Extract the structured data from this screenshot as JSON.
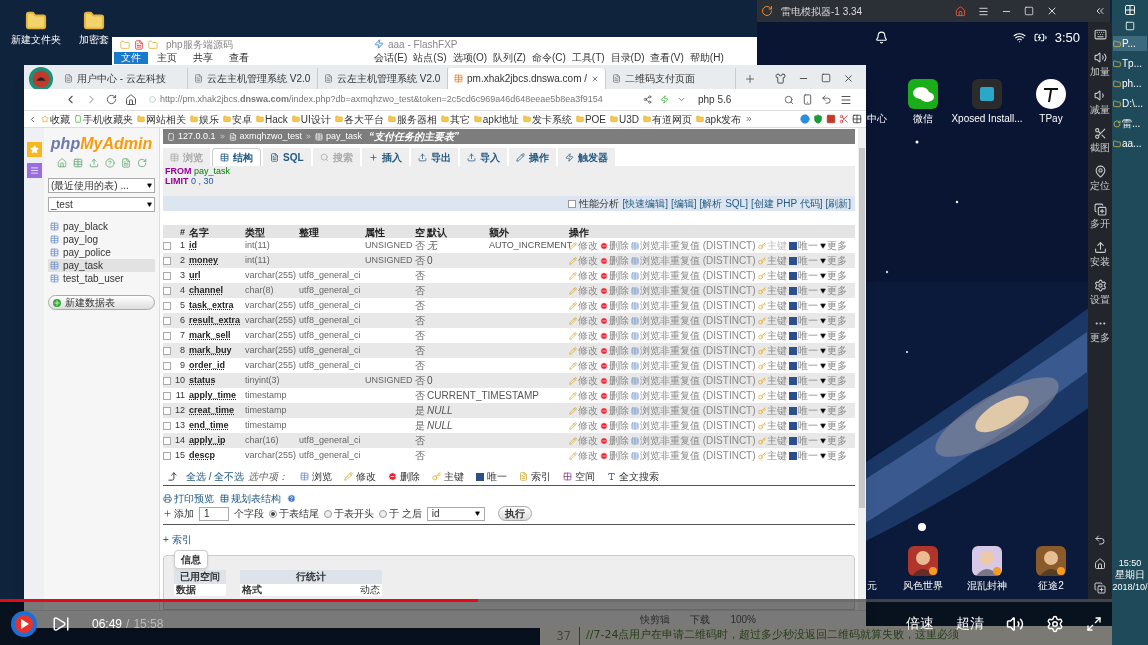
{
  "desktop": {
    "icons": [
      {
        "label": "新建文件夹"
      },
      {
        "label": "加密套"
      }
    ]
  },
  "explorer": {
    "title": "php服务端源码",
    "ribbon": [
      {
        "label": "文件",
        "selected": true
      },
      {
        "label": "主页",
        "selected": false
      },
      {
        "label": "共享",
        "selected": false
      },
      {
        "label": "查看",
        "selected": false
      }
    ]
  },
  "flashfxp": {
    "title": "aaa - FlashFXP",
    "menu": [
      "会话(E)",
      "站点(S)",
      "选项(O)",
      "队列(Z)",
      "命令(C)",
      "工具(T)",
      "目录(D)",
      "查看(V)",
      "帮助(H)"
    ]
  },
  "browser": {
    "tabs": [
      {
        "label": "用户中心 - 云左科技",
        "selected": false
      },
      {
        "label": "云左主机管理系统 V2.0",
        "selected": false
      },
      {
        "label": "云左主机管理系统 V2.0",
        "selected": false
      },
      {
        "label": "pm.xhak2jbcs.dnswa.com /",
        "selected": true
      },
      {
        "label": "二维码支付页面",
        "selected": false
      }
    ],
    "url": "http://pm.xhak2jbcs.**dnswa.com**/index.php?db=axmqhzwo_test&token=2c5cd6c969a46d648eeae5b8ea3f9154",
    "search": "php 5.6",
    "bookmarks": [
      "收藏",
      "手机收藏夹",
      "网站相关",
      "娱乐",
      "安卓",
      "Hack",
      "UI设计",
      "各大平台",
      "服务器相",
      "其它",
      "apk地址",
      "发卡系统",
      "POE",
      "U3D",
      "有道网页",
      "apk发布"
    ],
    "status": [
      "快剪辑",
      "下载",
      "100%"
    ]
  },
  "pma": {
    "logo": [
      "php",
      "MyAdmin"
    ],
    "sidebar": {
      "recent": "(最近使用的表) ...",
      "db": "_test",
      "tables": [
        {
          "name": "pay_black",
          "selected": false
        },
        {
          "name": "pay_log",
          "selected": false
        },
        {
          "name": "pay_police",
          "selected": false
        },
        {
          "name": "pay_task",
          "selected": true
        },
        {
          "name": "test_tab_user",
          "selected": false
        }
      ],
      "new_table": "新建数据表"
    },
    "breadcrumb": [
      "127.0.0.1",
      "axmqhzwo_test",
      "pay_task"
    ],
    "table_comment": "“支付任务的主要表”",
    "tabs": [
      {
        "label": "浏览",
        "selected": false,
        "disabled": true
      },
      {
        "label": "结构",
        "selected": true,
        "disabled": false
      },
      {
        "label": "SQL",
        "selected": false,
        "disabled": false
      },
      {
        "label": "搜索",
        "selected": false,
        "disabled": true
      },
      {
        "label": "插入",
        "selected": false,
        "disabled": false
      },
      {
        "label": "导出",
        "selected": false,
        "disabled": false
      },
      {
        "label": "导入",
        "selected": false,
        "disabled": false
      },
      {
        "label": "操作",
        "selected": false,
        "disabled": false
      },
      {
        "label": "触发器",
        "selected": false,
        "disabled": false
      }
    ],
    "sql": [
      {
        "keyword": "FROM",
        "rest": "pay_task"
      },
      {
        "keyword": "LIMIT",
        "rest": "0 , 30"
      }
    ],
    "profiling": {
      "label": "性能分析",
      "checked": false,
      "links": [
        "[快速编辑]",
        "[编辑]",
        "[解析 SQL]",
        "[创建 PHP 代码]",
        "[刷新]"
      ]
    },
    "columns": [
      "#",
      "名字",
      "类型",
      "整理",
      "属性",
      "空",
      "默认",
      "额外",
      "操作"
    ],
    "rows": [
      {
        "n": "1",
        "name": "id",
        "type": "int(11)",
        "collation": "",
        "attr": "UNSIGNED",
        "null": "否",
        "default": "无",
        "default_italic": true,
        "extra": "AUTO_INCREMENT",
        "checked": false,
        "primary": true,
        "actions": [
          "修改",
          "删除",
          "浏览非重复值 (DISTINCT)",
          "主键",
          "唯一",
          "更多"
        ]
      },
      {
        "n": "2",
        "name": "money",
        "type": "int(11)",
        "collation": "",
        "attr": "UNSIGNED",
        "null": "否",
        "default": "0",
        "default_italic": false,
        "extra": "",
        "checked": false,
        "primary": false,
        "actions": [
          "修改",
          "删除",
          "浏览非重复值 (DISTINCT)",
          "主键",
          "唯一",
          "更多"
        ]
      },
      {
        "n": "3",
        "name": "url",
        "type": "varchar(255)",
        "collation": "utf8_general_ci",
        "attr": "",
        "null": "否",
        "default": "",
        "extra": "",
        "checked": false,
        "primary": false,
        "actions": [
          "修改",
          "删除",
          "浏览非重复值 (DISTINCT)",
          "主键",
          "唯一",
          "更多"
        ]
      },
      {
        "n": "4",
        "name": "channel",
        "type": "char(8)",
        "collation": "utf8_general_ci",
        "attr": "",
        "null": "否",
        "default": "",
        "extra": "",
        "checked": false,
        "primary": false,
        "actions": [
          "修改",
          "删除",
          "浏览非重复值 (DISTINCT)",
          "主键",
          "唯一",
          "更多"
        ]
      },
      {
        "n": "5",
        "name": "task_extra",
        "type": "varchar(255)",
        "collation": "utf8_general_ci",
        "attr": "",
        "null": "否",
        "default": "",
        "extra": "",
        "checked": false,
        "primary": false,
        "actions": [
          "修改",
          "删除",
          "浏览非重复值 (DISTINCT)",
          "主键",
          "唯一",
          "更多"
        ]
      },
      {
        "n": "6",
        "name": "result_extra",
        "type": "varchar(255)",
        "collation": "utf8_general_ci",
        "attr": "",
        "null": "否",
        "default": "",
        "extra": "",
        "checked": false,
        "primary": false,
        "actions": [
          "修改",
          "删除",
          "浏览非重复值 (DISTINCT)",
          "主键",
          "唯一",
          "更多"
        ]
      },
      {
        "n": "7",
        "name": "mark_sell",
        "type": "varchar(255)",
        "collation": "utf8_general_ci",
        "attr": "",
        "null": "否",
        "default": "",
        "extra": "",
        "checked": false,
        "primary": false,
        "actions": [
          "修改",
          "删除",
          "浏览非重复值 (DISTINCT)",
          "主键",
          "唯一",
          "更多"
        ]
      },
      {
        "n": "8",
        "name": "mark_buy",
        "type": "varchar(255)",
        "collation": "utf8_general_ci",
        "attr": "",
        "null": "否",
        "default": "",
        "extra": "",
        "checked": false,
        "primary": false,
        "actions": [
          "修改",
          "删除",
          "浏览非重复值 (DISTINCT)",
          "主键",
          "唯一",
          "更多"
        ]
      },
      {
        "n": "9",
        "name": "order_id",
        "type": "varchar(255)",
        "collation": "utf8_general_ci",
        "attr": "",
        "null": "否",
        "default": "",
        "extra": "",
        "checked": false,
        "primary": false,
        "actions": [
          "修改",
          "删除",
          "浏览非重复值 (DISTINCT)",
          "主键",
          "唯一",
          "更多"
        ]
      },
      {
        "n": "10",
        "name": "status",
        "type": "tinyint(3)",
        "collation": "",
        "attr": "UNSIGNED",
        "null": "否",
        "default": "0",
        "default_italic": false,
        "extra": "",
        "checked": false,
        "primary": false,
        "actions": [
          "修改",
          "删除",
          "浏览非重复值 (DISTINCT)",
          "主键",
          "唯一",
          "更多"
        ]
      },
      {
        "n": "11",
        "name": "apply_time",
        "type": "timestamp",
        "collation": "",
        "attr": "",
        "null": "否",
        "default": "CURRENT_TIMESTAMP",
        "default_italic": false,
        "extra": "",
        "checked": false,
        "primary": false,
        "actions": [
          "修改",
          "删除",
          "浏览非重复值 (DISTINCT)",
          "主键",
          "唯一",
          "更多"
        ]
      },
      {
        "n": "12",
        "name": "creat_time",
        "type": "timestamp",
        "collation": "",
        "attr": "",
        "null": "是",
        "default": "NULL",
        "default_italic": true,
        "extra": "",
        "checked": false,
        "primary": false,
        "actions": [
          "修改",
          "删除",
          "浏览非重复值 (DISTINCT)",
          "主键",
          "唯一",
          "更多"
        ]
      },
      {
        "n": "13",
        "name": "end_time",
        "type": "timestamp",
        "collation": "",
        "attr": "",
        "null": "是",
        "default": "NULL",
        "default_italic": true,
        "extra": "",
        "checked": false,
        "primary": false,
        "actions": [
          "修改",
          "删除",
          "浏览非重复值 (DISTINCT)",
          "主键",
          "唯一",
          "更多"
        ]
      },
      {
        "n": "14",
        "name": "apply_ip",
        "type": "char(16)",
        "collation": "utf8_general_ci",
        "attr": "",
        "null": "否",
        "default": "",
        "extra": "",
        "checked": false,
        "primary": false,
        "actions": [
          "修改",
          "删除",
          "浏览非重复值 (DISTINCT)",
          "主键",
          "唯一",
          "更多"
        ]
      },
      {
        "n": "15",
        "name": "descp",
        "type": "varchar(255)",
        "collation": "utf8_general_ci",
        "attr": "",
        "null": "否",
        "default": "",
        "extra": "",
        "checked": false,
        "primary": false,
        "actions": [
          "修改",
          "删除",
          "浏览非重复值 (DISTINCT)",
          "主键",
          "唯一",
          "更多"
        ]
      }
    ],
    "bulk": {
      "select_all": "全选 / 全不选",
      "with_selected": "选中项：",
      "actions": [
        {
          "kind": "browse",
          "label": "浏览"
        },
        {
          "kind": "edit",
          "label": "修改"
        },
        {
          "kind": "drop",
          "label": "删除"
        },
        {
          "kind": "primary",
          "label": "主键"
        },
        {
          "kind": "unique",
          "label": "唯一"
        },
        {
          "kind": "index",
          "label": "索引"
        },
        {
          "kind": "spatial",
          "label": "空间"
        },
        {
          "kind": "fulltext",
          "label": "全文搜索"
        }
      ]
    },
    "print": "打印预览",
    "plan": "规划表结构",
    "add": {
      "label": "添加",
      "value": "1",
      "unit": "个字段",
      "positions": [
        {
          "label": "于表结尾",
          "selected": true
        },
        {
          "label": "于表开头",
          "selected": false
        },
        {
          "label": "于 之后",
          "selected": false
        }
      ],
      "after": "id",
      "go": "执行"
    },
    "index_link": "+ 索引",
    "info": {
      "legend": "信息",
      "headers": [
        "已用空间",
        "行统计"
      ],
      "rows": [
        {
          "label": "数据",
          "stat": "格式",
          "value": "动态"
        }
      ]
    }
  },
  "emulator": {
    "title": "雷电模拟器-1 3.34",
    "clock": "3:50",
    "top_apps": [
      {
        "label": "中心"
      },
      {
        "label": "微信"
      },
      {
        "label": "Xposed Install..."
      },
      {
        "label": "TPay"
      }
    ],
    "bottom_apps": [
      {
        "label": "元"
      },
      {
        "label": "风色世界"
      },
      {
        "label": "混乱封神"
      },
      {
        "label": "征途2"
      }
    ],
    "tools": [
      {
        "kind": "volume-up",
        "label": "加量"
      },
      {
        "kind": "volume-down",
        "label": "减量"
      },
      {
        "kind": "screenshot",
        "label": "截图"
      },
      {
        "kind": "location",
        "label": "定位"
      },
      {
        "kind": "multi",
        "label": "多开"
      },
      {
        "kind": "install",
        "label": "安装"
      },
      {
        "kind": "settings",
        "label": "设置"
      },
      {
        "kind": "more",
        "label": "更多"
      }
    ]
  },
  "taskbar": {
    "items": [
      "P...",
      "Tp...",
      "ph...",
      "D:\\...",
      "雷...",
      "aa..."
    ],
    "time": "15:50",
    "weekday": "星期日",
    "date": "2018/10/"
  },
  "editor": {
    "line": "37",
    "code": "//7-24点用户在申请二维码时，超过多少秒没返回二维码就算失败，这里必须"
  },
  "player": {
    "current": "06:49",
    "total": "15:58",
    "separator": "/",
    "level": 0.43,
    "speed": "倍速",
    "quality": "超清"
  }
}
